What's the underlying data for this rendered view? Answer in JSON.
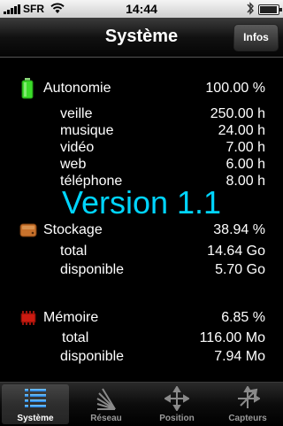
{
  "status_bar": {
    "carrier": "SFR",
    "time": "14:44",
    "signal_icon": "signal-bars-icon",
    "wifi_icon": "wifi-icon",
    "bluetooth_icon": "bluetooth-icon",
    "battery_icon": "battery-icon"
  },
  "nav": {
    "title": "Système",
    "info_button": "Infos"
  },
  "autonomie": {
    "title": "Autonomie",
    "value": "100.00 %",
    "icon": "battery-green-icon",
    "rows": [
      {
        "label": "veille",
        "value": "250.00 h"
      },
      {
        "label": "musique",
        "value": "24.00 h"
      },
      {
        "label": "vidéo",
        "value": "7.00 h"
      },
      {
        "label": "web",
        "value": "6.00 h"
      },
      {
        "label": "téléphone",
        "value": "8.00 h"
      }
    ]
  },
  "version_text": "Version 1.1",
  "stockage": {
    "title": "Stockage",
    "value": "38.94 %",
    "icon": "storage-icon",
    "rows": [
      {
        "label": "total",
        "value": "14.64 Go"
      },
      {
        "label": "disponible",
        "value": "5.70 Go"
      }
    ]
  },
  "memoire": {
    "title": "Mémoire",
    "value": "6.85 %",
    "icon": "memory-chip-icon",
    "rows": [
      {
        "label": "total",
        "value": "116.00 Mo"
      },
      {
        "label": "disponible",
        "value": "7.94 Mo"
      }
    ]
  },
  "tabs": [
    {
      "label": "Système",
      "icon": "list-icon",
      "active": true
    },
    {
      "label": "Réseau",
      "icon": "network-icon",
      "active": false
    },
    {
      "label": "Position",
      "icon": "position-icon",
      "active": false
    },
    {
      "label": "Capteurs",
      "icon": "sensors-icon",
      "active": false
    }
  ],
  "colors": {
    "version": "#00d5ff",
    "battery_green": "#3bdc2a",
    "storage_orange": "#c8722c",
    "memory_red": "#cc1a10"
  }
}
